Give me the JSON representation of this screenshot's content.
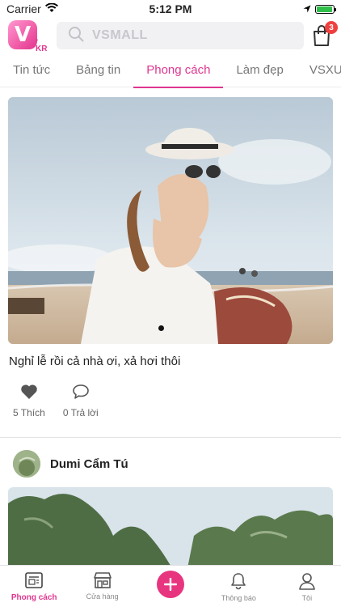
{
  "status_bar": {
    "carrier": "Carrier",
    "time": "5:12 PM",
    "battery_level": 0.95
  },
  "header": {
    "logo_letter": "V",
    "logo_sub": "-KR",
    "search_placeholder": "VSMALL",
    "search_icon": "search-icon",
    "cart_icon": "shopping-bag-icon",
    "cart_count": "3"
  },
  "tabs": [
    {
      "label": "Tin tức"
    },
    {
      "label": "Bảng tin"
    },
    {
      "label": "Phong cách",
      "active": true
    },
    {
      "label": "Làm đẹp"
    },
    {
      "label": "VSXU"
    }
  ],
  "post1": {
    "caption": "Nghỉ lễ rồi cả nhà ơi, xả hơi thôi",
    "likes": "5 Thích",
    "comments": "0 Trả lời",
    "like_icon": "heart-icon",
    "comment_icon": "comment-icon"
  },
  "post2": {
    "author": "Dumi Cẩm Tú"
  },
  "bottom_nav": [
    {
      "label": "Phong cách",
      "icon": "news-icon",
      "active": true
    },
    {
      "label": "Cửa hàng",
      "icon": "store-icon"
    },
    {
      "label": "",
      "icon": "plus-icon"
    },
    {
      "label": "Thông báo",
      "icon": "bell-icon"
    },
    {
      "label": "Tôi",
      "icon": "user-icon"
    }
  ],
  "colors": {
    "accent": "#e0368f",
    "badge": "#ef4040"
  }
}
